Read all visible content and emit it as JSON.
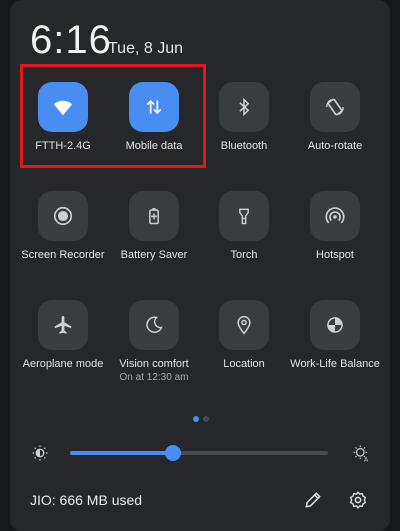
{
  "header": {
    "time": "6:16",
    "date": "Tue, 8 Jun"
  },
  "tiles": [
    {
      "label": "FTTH-2.4G",
      "icon": "wifi-icon",
      "active": true
    },
    {
      "label": "Mobile data",
      "icon": "mobile-data-icon",
      "active": true
    },
    {
      "label": "Bluetooth",
      "icon": "bluetooth-icon",
      "active": false
    },
    {
      "label": "Auto-rotate",
      "icon": "auto-rotate-icon",
      "active": false
    },
    {
      "label": "Screen Recorder",
      "icon": "screen-recorder-icon",
      "active": false
    },
    {
      "label": "Battery Saver",
      "icon": "battery-saver-icon",
      "active": false
    },
    {
      "label": "Torch",
      "icon": "torch-icon",
      "active": false
    },
    {
      "label": "Hotspot",
      "icon": "hotspot-icon",
      "active": false
    },
    {
      "label": "Aeroplane mode",
      "icon": "aeroplane-icon",
      "active": false
    },
    {
      "label": "Vision comfort",
      "sub": "On at 12:30 am",
      "icon": "moon-icon",
      "active": false
    },
    {
      "label": "Location",
      "icon": "location-icon",
      "active": false
    },
    {
      "label": "Work-Life Balance",
      "icon": "work-life-icon",
      "active": false
    }
  ],
  "brightness": {
    "level": 0.4
  },
  "footer": {
    "usage": "JIO: 666 MB used"
  },
  "colors": {
    "accent": "#4a8df1",
    "highlight": "#e3171d",
    "tile": "#3a3c40"
  }
}
